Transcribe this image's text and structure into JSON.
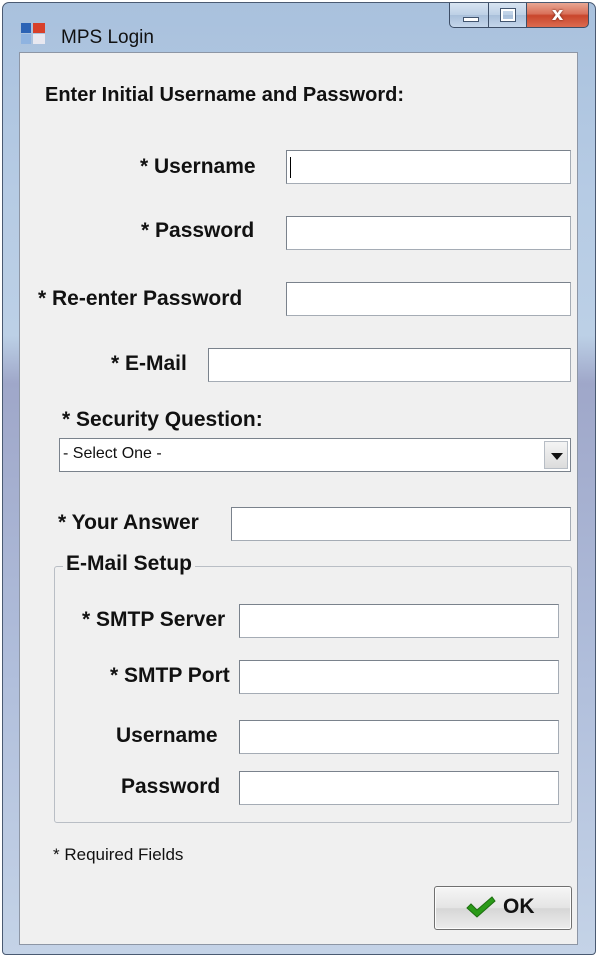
{
  "window": {
    "title": "MPS Login",
    "controls": {
      "minimize": "minimize",
      "maximize": "maximize",
      "close": "x"
    }
  },
  "form": {
    "heading": "Enter Initial Username and Password:",
    "username_label": "* Username",
    "username_value": "",
    "password_label": "* Password",
    "password_value": "",
    "reenter_label": "* Re-enter Password",
    "reenter_value": "",
    "email_label": "* E-Mail",
    "email_value": "",
    "security_question_label": "* Security Question:",
    "security_question_selected": "- Select One -",
    "answer_label": "* Your Answer",
    "answer_value": ""
  },
  "email_setup": {
    "title": "E-Mail Setup",
    "smtp_server_label": "* SMTP Server",
    "smtp_server_value": "",
    "smtp_port_label": "* SMTP Port",
    "smtp_port_value": "",
    "username_label": "Username",
    "username_value": "",
    "password_label": "Password",
    "password_value": ""
  },
  "footer": {
    "required_note": "* Required Fields",
    "ok_label": "OK",
    "ok_icon": "checkmark-icon"
  },
  "colors": {
    "checkmark": "#2a9a18",
    "close_button": "#c8462c",
    "dialog_bg": "#f0f0f0"
  }
}
